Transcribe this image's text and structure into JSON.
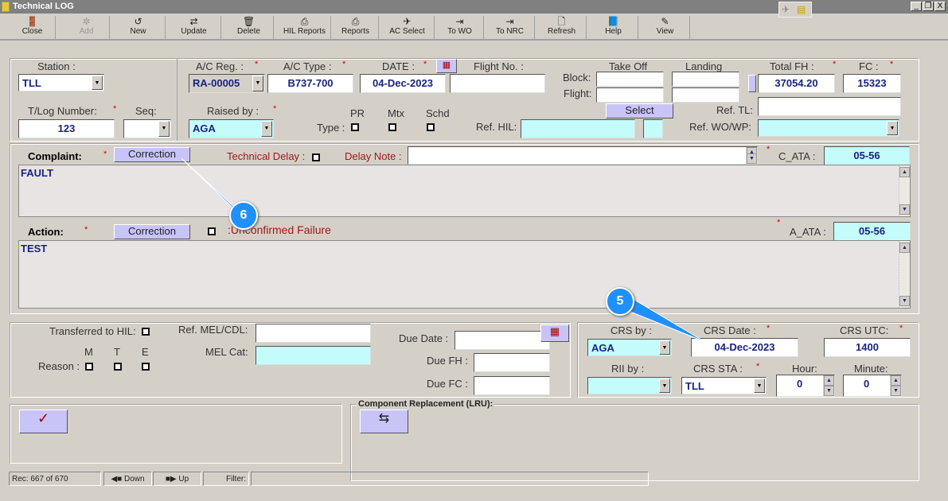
{
  "window": {
    "title": "Technical LOG",
    "min": "_",
    "restore": "❐",
    "close": "X"
  },
  "toolbar": [
    {
      "label": "Close",
      "icon": "door-icon",
      "glyph": "🚪"
    },
    {
      "label": "Add",
      "icon": "add-icon",
      "glyph": "✲"
    },
    {
      "label": "New",
      "icon": "new-icon",
      "glyph": "↺"
    },
    {
      "label": "Update",
      "icon": "update-icon",
      "glyph": "⇄"
    },
    {
      "label": "Delete",
      "icon": "trash-icon",
      "glyph": "🗑"
    },
    {
      "label": "HIL Reports",
      "icon": "printer-icon",
      "glyph": "⎙"
    },
    {
      "label": "Reports",
      "icon": "printer-icon",
      "glyph": "⎙"
    },
    {
      "label": "AC Select",
      "icon": "airplane-icon",
      "glyph": "✈"
    },
    {
      "label": "To WO",
      "icon": "to-wo-icon",
      "glyph": "⇥"
    },
    {
      "label": "To NRC",
      "icon": "to-nrc-icon",
      "glyph": "⇥"
    },
    {
      "label": "Refresh",
      "icon": "page-icon",
      "glyph": "🗋"
    },
    {
      "label": "Help",
      "icon": "book-icon",
      "glyph": "📘"
    },
    {
      "label": "View",
      "icon": "view-icon",
      "glyph": "✎"
    }
  ],
  "header": {
    "station_label": "Station :",
    "station": "TLL",
    "tlog_label": "T/Log Number:",
    "tlog": "123",
    "seq_label": "Seq:",
    "seq": "",
    "acreg_label": "A/C Reg. :",
    "acreg": "RA-00005",
    "actype_label": "A/C Type :",
    "actype": "B737-700",
    "date_label": "DATE :",
    "date": "04-Dec-2023",
    "flight_label": "Flight No. :",
    "flight": "",
    "raised_label": "Raised by :",
    "raised": "AGA",
    "type_label": "Type :",
    "pr": "PR",
    "mtx": "Mtx",
    "schd": "Schd",
    "takeoff": "Take Off",
    "landing": "Landing",
    "block": "Block:",
    "flight_row": "Flight:",
    "select": "Select",
    "refhil_label": "Ref. HIL:",
    "totalfh_label": "Total FH :",
    "totalfh": "37054.20",
    "fc_label": "FC :",
    "fc": "15323",
    "reftl_label": "Ref. TL:",
    "refwo_label": "Ref. WO/WP:",
    "req": "*"
  },
  "complaint": {
    "label": "Complaint:",
    "correction": "Correction",
    "techdelay": "Technical Delay :",
    "delaynote": "Delay Note :",
    "cata_label": "C_ATA :",
    "cata": "05-56",
    "text": "FAULT"
  },
  "action": {
    "label": "Action:",
    "correction": "Correction",
    "unconfirmed": ":Unconfirmed Failure",
    "aata_label": "A_ATA :",
    "aata": "05-56",
    "text": "TEST"
  },
  "hil": {
    "transferred": "Transferred to HIL:",
    "refmel": "Ref. MEL/CDL:",
    "melcat": "MEL Cat:",
    "m": "M",
    "t": "T",
    "e": "E",
    "reason": "Reason :",
    "duedate": "Due Date :",
    "duefh": "Due FH :",
    "duefc": "Due FC :"
  },
  "crs": {
    "crsby_label": "CRS by :",
    "crsby": "AGA",
    "crsdate_label": "CRS Date :",
    "crsdate": "04-Dec-2023",
    "crsutc_label": "CRS UTC:",
    "crsutc": "1400",
    "rii_label": "RII by :",
    "crssta_label": "CRS STA :",
    "crssta": "TLL",
    "hour_label": "Hour:",
    "hour": "0",
    "minute_label": "Minute:",
    "minute": "0"
  },
  "component": {
    "title": "Component Replacement (LRU):"
  },
  "status": {
    "rec": "Rec: 667 of 670",
    "down": "Down",
    "up": "Up",
    "filter": "Filter:"
  },
  "callouts": [
    "6",
    "5"
  ]
}
